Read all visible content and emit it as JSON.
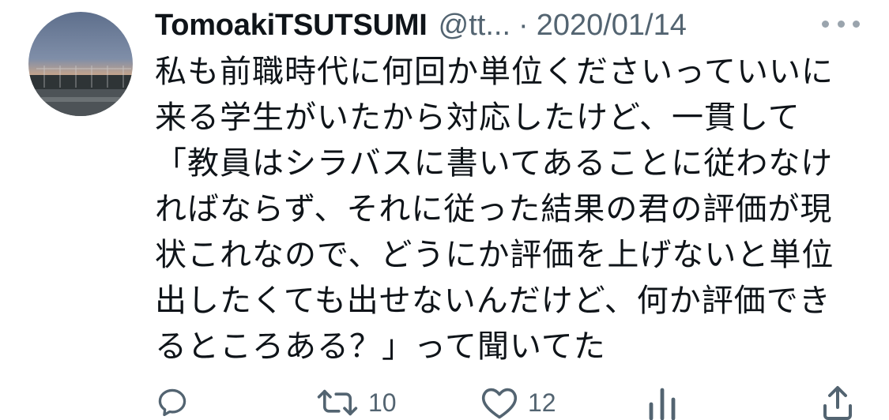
{
  "author": {
    "display_name": "TomoakiTSUTSUMI",
    "handle": "@tt...",
    "separator": "·",
    "date": "2020/01/14"
  },
  "tweet": {
    "lines": [
      "私も前職時代に何回か単位くださいっていいに",
      "来る学生がいたから対応したけど、一貫して",
      "「教員はシラバスに書いてあることに従わなけ",
      "ればならず、それに従った結果の君の評価が現",
      "状これなので、どうにか評価を上げないと単位",
      "出したくても出せないんだけど、何か評価でき",
      "るところある？」って聞いてた"
    ]
  },
  "actions": {
    "reply_icon": "reply-icon",
    "retweet_icon": "retweet-icon",
    "retweet_count": "10",
    "like_icon": "heart-icon",
    "like_count": "12",
    "analytics_icon": "analytics-icon",
    "share_icon": "share-icon"
  },
  "colors": {
    "text": "#0f1419",
    "secondary": "#536471",
    "background": "#ffffff"
  }
}
